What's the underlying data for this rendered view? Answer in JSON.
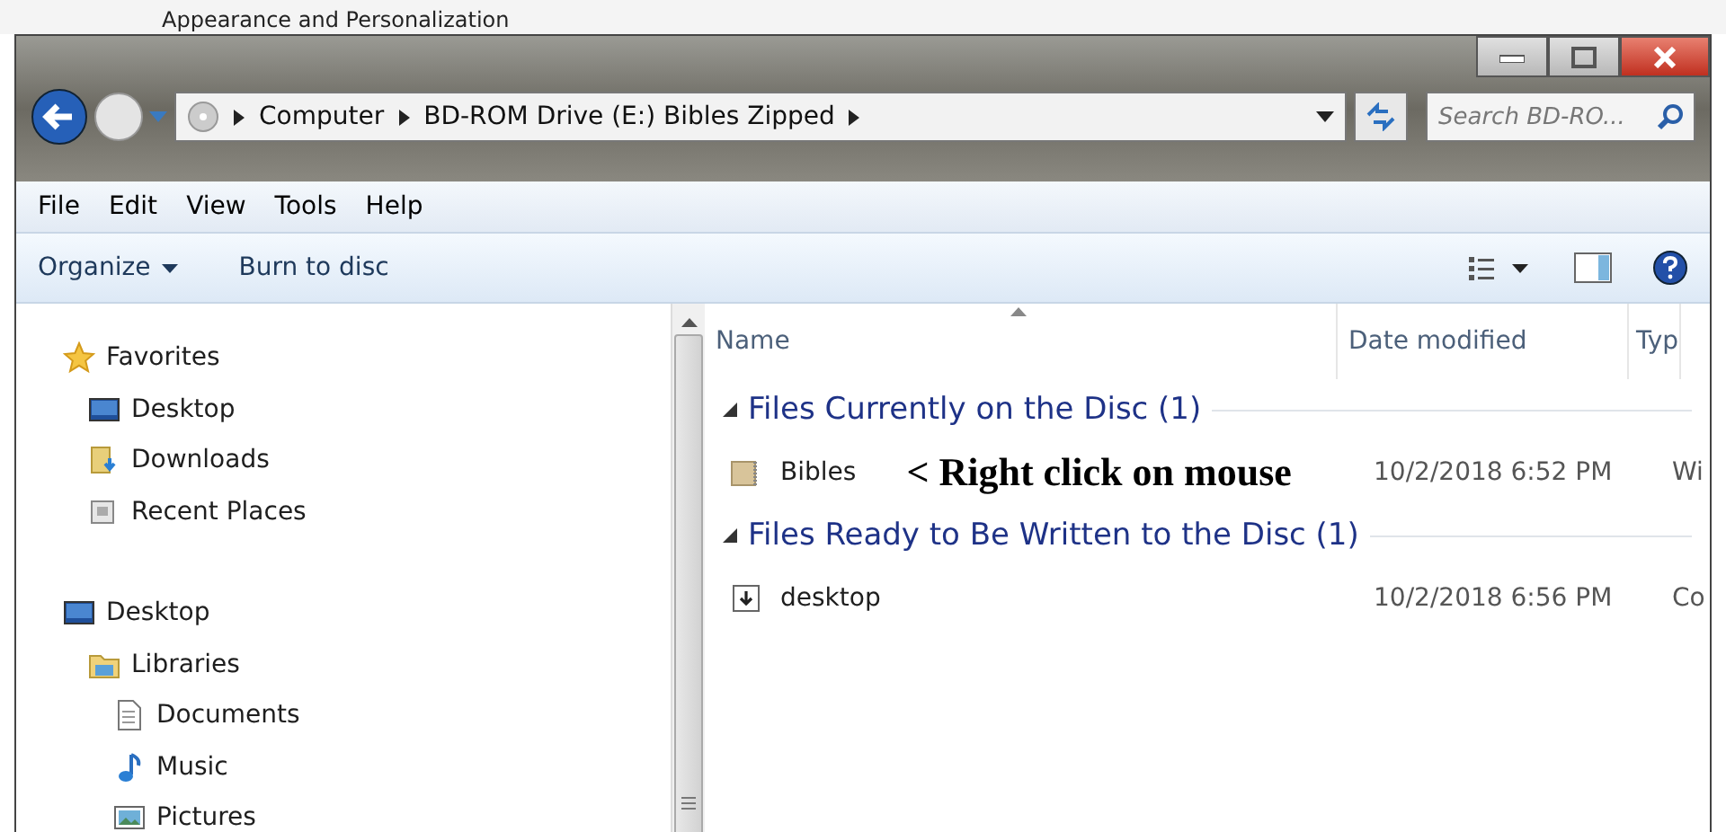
{
  "background_window": {
    "title": "Appearance and Personalization"
  },
  "address_bar": {
    "breadcrumbs": [
      "Computer",
      "BD-ROM Drive (E:) Bibles Zipped"
    ]
  },
  "search": {
    "placeholder": "Search BD-RO..."
  },
  "menu_bar": [
    "File",
    "Edit",
    "View",
    "Tools",
    "Help"
  ],
  "command_bar": [
    {
      "label": "Organize",
      "kind": "dropdown"
    },
    {
      "label": "Burn to disc",
      "kind": "plain"
    }
  ],
  "navigation": [
    {
      "label": "Favorites",
      "kind": "star",
      "children": [
        {
          "label": "Desktop",
          "kind": "desktop"
        },
        {
          "label": "Downloads",
          "kind": "downloads"
        },
        {
          "label": "Recent Places",
          "kind": "recent"
        }
      ]
    },
    {
      "label": "Desktop",
      "kind": "desktop",
      "children": [
        {
          "label": "Libraries",
          "kind": "library",
          "children": [
            {
              "label": "Documents",
              "kind": "document"
            },
            {
              "label": "Music",
              "kind": "music"
            },
            {
              "label": "Pictures",
              "kind": "pictures"
            }
          ]
        }
      ]
    }
  ],
  "file_list": {
    "columns": [
      {
        "label": "Name",
        "sorted": true
      },
      {
        "label": "Date modified",
        "sorted": false
      },
      {
        "label": "Typ",
        "sorted": false
      }
    ],
    "groups": [
      {
        "title": "Files Currently on the Disc (1)",
        "expanded": true,
        "items": [
          {
            "name": "Bibles",
            "kind": "zip",
            "annotation": "< Right click on mouse",
            "date": "10/2/2018 6:52 PM",
            "type": "Wi"
          }
        ]
      },
      {
        "title": "Files Ready to Be Written to the Disc (1)",
        "expanded": true,
        "items": [
          {
            "name": "desktop",
            "kind": "shortcut",
            "date": "10/2/2018 6:56 PM",
            "type": "Co"
          }
        ]
      }
    ]
  }
}
